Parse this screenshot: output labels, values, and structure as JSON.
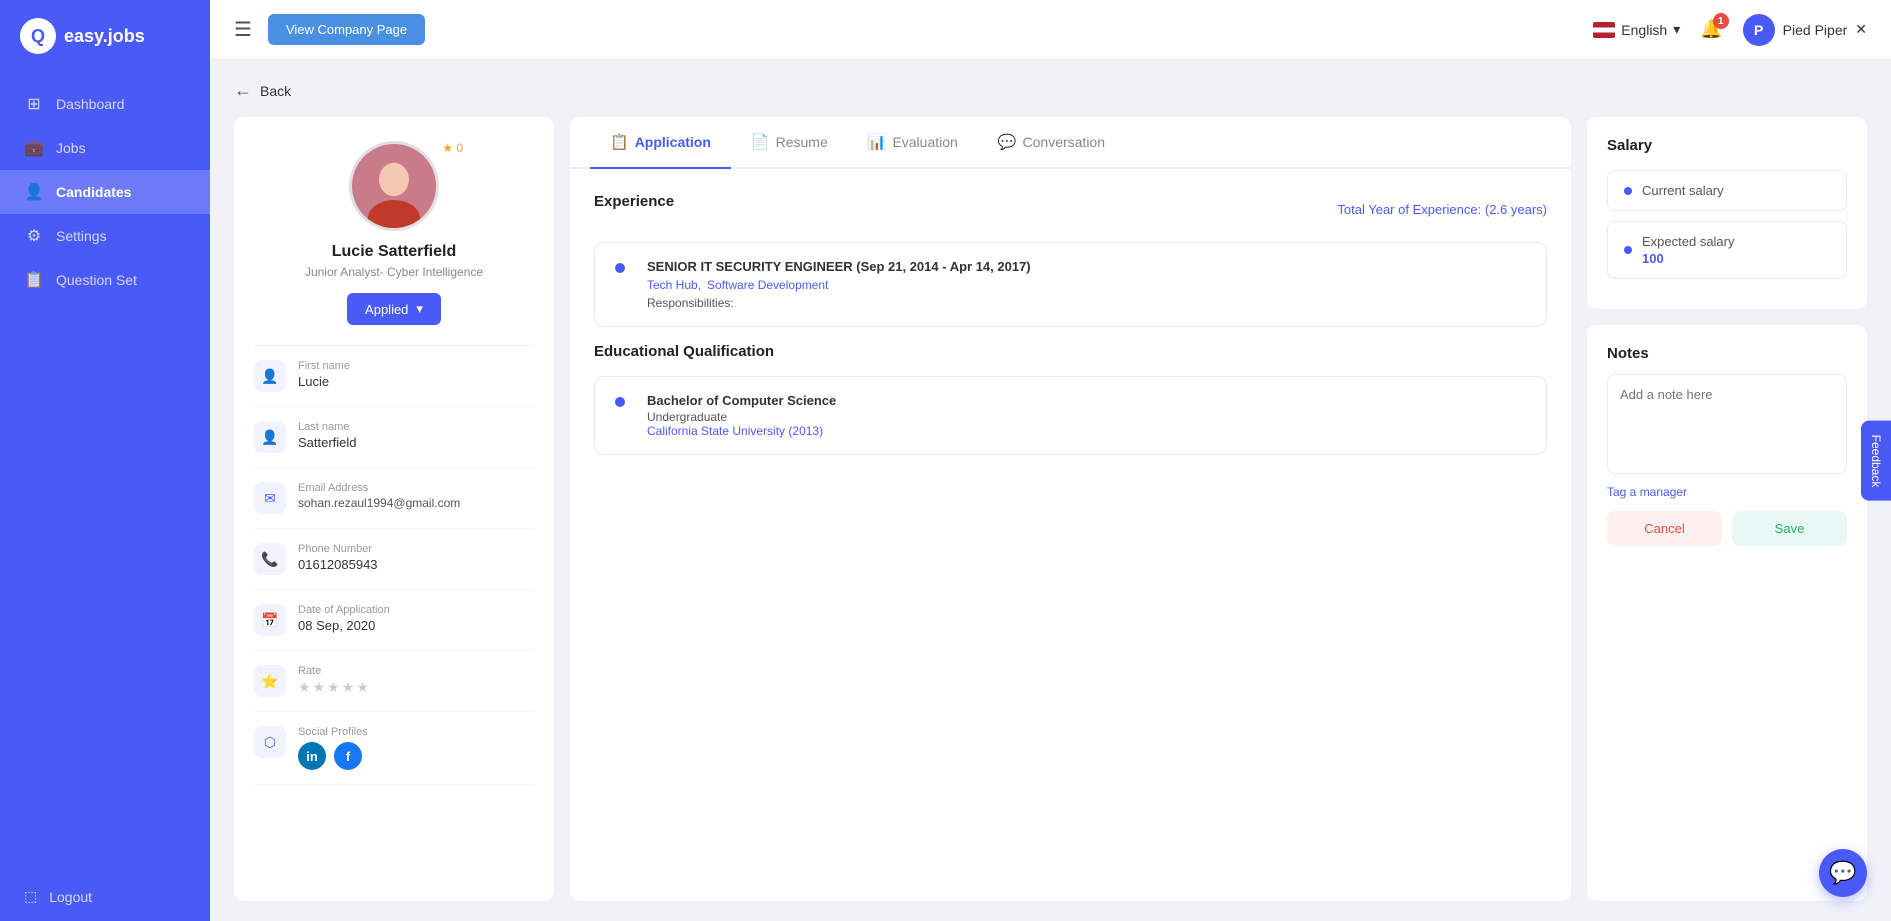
{
  "app": {
    "name": "easy.jobs",
    "logo_letter": "Q"
  },
  "topbar": {
    "hamburger_label": "☰",
    "view_company_btn": "View Company Page",
    "language": "English",
    "language_chevron": "▾",
    "notification_count": "1",
    "company_name": "Pied Piper",
    "company_initial": "P"
  },
  "sidebar": {
    "items": [
      {
        "label": "Dashboard",
        "icon": "⊞"
      },
      {
        "label": "Jobs",
        "icon": "💼"
      },
      {
        "label": "Candidates",
        "icon": "👤"
      },
      {
        "label": "Settings",
        "icon": "⚙"
      },
      {
        "label": "Question Set",
        "icon": "📋"
      }
    ],
    "logout": "Logout"
  },
  "back_btn": "Back",
  "candidate": {
    "name": "Lucie Satterfield",
    "title": "Junior Analyst- Cyber Intelligence",
    "status": "Applied",
    "star_count": "★ 0",
    "fields": {
      "first_name_label": "First name",
      "first_name": "Lucie",
      "last_name_label": "Last name",
      "last_name": "Satterfield",
      "email_label": "Email Address",
      "email": "sohan.rezaul1994@gmail.com",
      "phone_label": "Phone Number",
      "phone": "01612085943",
      "doa_label": "Date of Application",
      "doa": "08 Sep, 2020",
      "rate_label": "Rate",
      "social_label": "Social Profiles"
    }
  },
  "tabs": [
    {
      "label": "Application",
      "icon": "📋",
      "active": true
    },
    {
      "label": "Resume",
      "icon": "📄",
      "active": false
    },
    {
      "label": "Evaluation",
      "icon": "📊",
      "active": false
    },
    {
      "label": "Conversation",
      "icon": "💬",
      "active": false
    }
  ],
  "experience": {
    "section_title": "Experience",
    "total_label": "Total Year of Experience:",
    "total_value": "(2.6 years)",
    "items": [
      {
        "title": "SENIOR IT SECURITY ENGINEER (Sep 21, 2014 - Apr 14, 2017)",
        "tags": [
          "Tech Hub,",
          "Software Development"
        ],
        "resp_label": "Responsibilities:"
      }
    ]
  },
  "education": {
    "section_title": "Educational Qualification",
    "items": [
      {
        "degree": "Bachelor of Computer Science",
        "type": "Undergraduate",
        "university": "California State University",
        "year": "(2013)"
      }
    ]
  },
  "salary": {
    "section_title": "Salary",
    "current_label": "Current salary",
    "expected_label": "Expected salary",
    "expected_value": "100"
  },
  "notes": {
    "section_title": "Notes",
    "placeholder": "Add a note here",
    "tag_manager": "Tag a manager",
    "cancel_btn": "Cancel",
    "save_btn": "Save"
  },
  "feedback_tab": "Feedback",
  "chat_icon": "💬"
}
